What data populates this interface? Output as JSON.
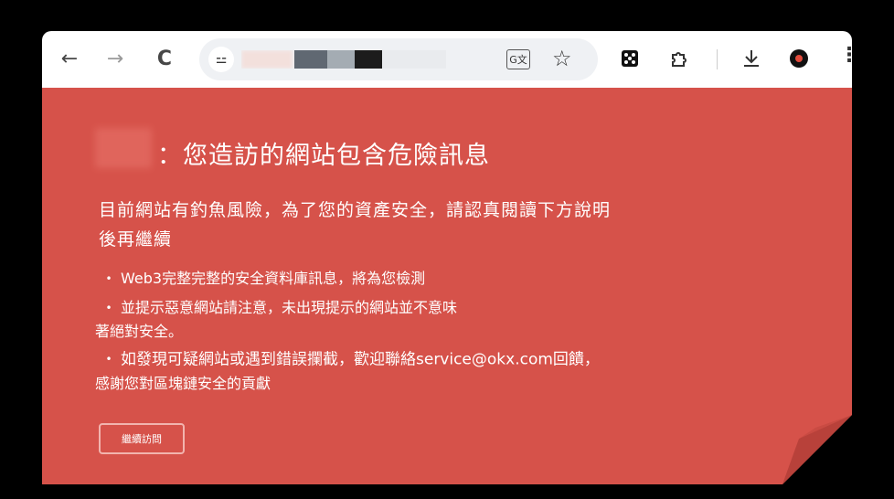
{
  "browser": {
    "back_icon": "←",
    "forward_icon": "→",
    "reload_icon": "C",
    "site_info_icon": "⚍",
    "address_url": "",
    "translate_icon": "G文",
    "bookmark_icon": "☆",
    "extensions": [
      "dice-icon",
      "puzzle-icon",
      "download-icon",
      "profile-icon"
    ],
    "menu_icon": "⋮"
  },
  "warning_page": {
    "headline": "：您造訪的網站包含危險訊息",
    "intro_line1": "目前網站有釣魚風險，為了您的資產安全，請認真閱讀下方說明",
    "intro_line2": "後再繼續",
    "bullets": [
      {
        "line1": "Web3完整完整的安全資料庫訊息，將為您檢測",
        "line2": ""
      },
      {
        "line1": "並提示惡意網站請注意，未出現提示的網站並不意味",
        "line2": "著絕對安全。"
      },
      {
        "line1": "如發現可疑網站或遇到錯誤攔截，歡迎聯絡service@okx.com回饋，",
        "line2": "感謝您對區塊鏈安全的貢獻"
      }
    ],
    "continue_button": "繼續訪問"
  },
  "colors": {
    "warning_background": "#d6524a",
    "toolbar_background": "#ffffff",
    "omnibox_background": "#eff1f4"
  }
}
